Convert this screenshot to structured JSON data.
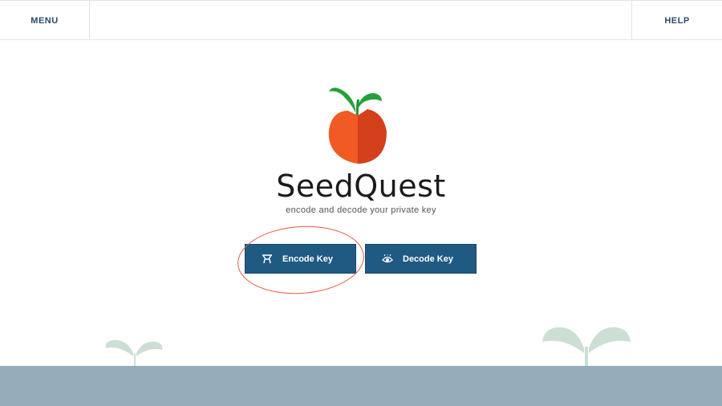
{
  "nav": {
    "menu_label": "MENU",
    "help_label": "HELP"
  },
  "app": {
    "title": "SeedQuest",
    "subtitle": "encode and decode your private key"
  },
  "buttons": {
    "encode_label": "Encode Key",
    "decode_label": "Decode Key"
  },
  "colors": {
    "nav_text": "#2c4a6b",
    "button_bg": "#1f5a82",
    "highlight_ring": "#e25a45",
    "logo_orange": "#f15a22",
    "logo_leaf": "#22a139",
    "ground": "#96acbb",
    "sprout": "#cddfd5"
  },
  "icons": {
    "encode": "encode-icon",
    "decode": "eye-icon",
    "logo": "seed-sprout-logo"
  }
}
